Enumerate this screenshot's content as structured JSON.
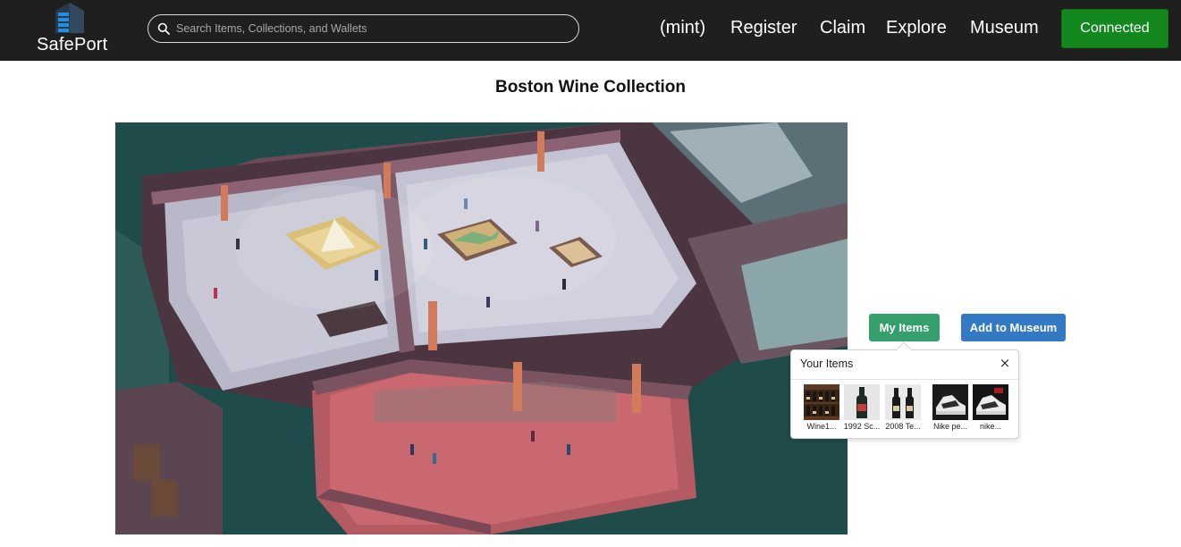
{
  "header": {
    "logo_text": "SafePort",
    "search": {
      "placeholder": "Search Items, Collections, and Wallets",
      "value": ""
    },
    "nav": [
      {
        "label": "(mint)"
      },
      {
        "label": "Register"
      },
      {
        "label": "Claim"
      },
      {
        "label": "Explore"
      },
      {
        "label": "Museum"
      }
    ],
    "connect_button": "Connected"
  },
  "main": {
    "title": "Boston Wine Collection",
    "image_alt": "3D museum gallery view",
    "buttons": {
      "my_items": "My Items",
      "add_to_museum": "Add to Museum"
    },
    "popover": {
      "title": "Your Items",
      "close": "×",
      "items": [
        {
          "label": "Wine1...",
          "thumb": "wine-rack"
        },
        {
          "label": "1992 Sc...",
          "thumb": "wine-bottle"
        },
        {
          "label": "2008 Te...",
          "thumb": "wine-bottles"
        },
        {
          "label": "Nike pe...",
          "thumb": "sneaker"
        },
        {
          "label": "nike...",
          "thumb": "sneaker"
        }
      ]
    }
  },
  "colors": {
    "header_bg": "#1f1f1f",
    "connected": "#12881f",
    "my_items": "#35a06b",
    "add_to_museum": "#3379c3"
  }
}
